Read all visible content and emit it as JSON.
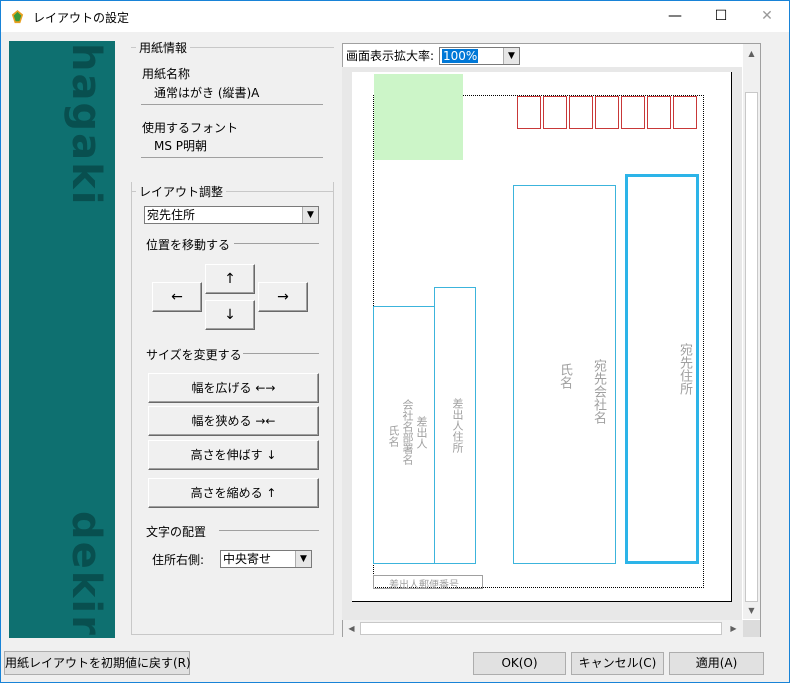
{
  "window": {
    "title": "レイアウトの設定",
    "minimize_icon": "—",
    "maximize_icon": "☐",
    "close_icon": "✕"
  },
  "banner": {
    "word_top": "hagaki",
    "word_bottom": "dekiru",
    "color": "#0e7070"
  },
  "paper_info": {
    "group_title": "用紙情報",
    "paper_name_label": "用紙名称",
    "paper_name_value": "通常はがき (縦書)A",
    "font_label": "使用するフォント",
    "font_value": "MS P明朝"
  },
  "layout_adjust": {
    "group_title": "レイアウト調整",
    "target_select": "宛先住所",
    "move_section": "位置を移動する",
    "arrows": {
      "up": "↑",
      "down": "↓",
      "left": "←",
      "right": "→"
    },
    "size_section": "サイズを変更する",
    "widen": "幅を広げる ←→",
    "narrow": "幅を狭める →←",
    "taller": "高さを伸ばす ↓",
    "shorter": "高さを縮める ↑",
    "text_section": "文字の配置",
    "alignment_label": "住所右側:",
    "alignment_value": "中央寄せ"
  },
  "preview": {
    "zoom_label": "画面表示拡大率:",
    "zoom_value": "100%",
    "fields": {
      "recipient_address": "宛先住所",
      "recipient_company": "宛先会社名",
      "recipient_name": "氏名",
      "sender_address": "差出人住所",
      "sender_company_line1": "差出人",
      "sender_company_line2": "会社名部署名",
      "sender_name": "氏名",
      "sender_zip": "差出人郵便番号"
    },
    "scroll_up": "▲",
    "scroll_down": "▼",
    "scroll_left": "◀",
    "scroll_right": "▶"
  },
  "footer": {
    "reset_button": "用紙レイアウトを初期値に戻す(R)",
    "ok_button": "OK(O)",
    "cancel_button": "キャンセル(C)",
    "apply_button": "適用(A)"
  },
  "colors": {
    "accent": "#0078d7",
    "stamp_area": "#ccf5c8",
    "zip_box": "#c83838",
    "field_border": "#3cb4dc"
  }
}
